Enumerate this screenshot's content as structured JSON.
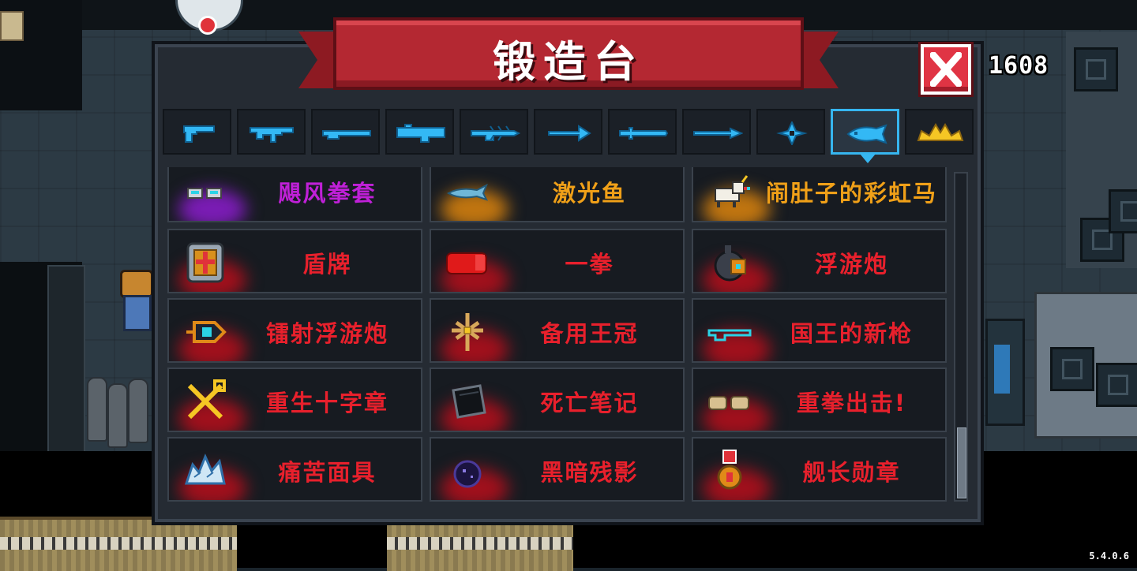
{
  "header": {
    "title": "锻造台",
    "coins": "1608"
  },
  "version": "5.4.0.6",
  "tabs": [
    {
      "icon": "pistol-icon"
    },
    {
      "icon": "assault-rifle-icon"
    },
    {
      "icon": "shotgun-icon"
    },
    {
      "icon": "heavy-gun-icon"
    },
    {
      "icon": "spiky-gun-icon"
    },
    {
      "icon": "bow-icon"
    },
    {
      "icon": "sword-icon"
    },
    {
      "icon": "spear-icon"
    },
    {
      "icon": "shuriken-icon"
    },
    {
      "icon": "fish-icon",
      "selected": true
    },
    {
      "icon": "crown-icon"
    }
  ],
  "items": [
    {
      "name": "飓风拳套",
      "color": "#c020d8",
      "glow": "#7a1cb4",
      "icon": "hurricane-gauntlet-icon"
    },
    {
      "name": "激光鱼",
      "color": "#f0a018",
      "glow": "#c07510",
      "icon": "laser-fish-icon"
    },
    {
      "name": "闹肚子的彩虹马",
      "color": "#f0a018",
      "glow": "#c07510",
      "icon": "rainbow-unicorn-icon"
    },
    {
      "name": "盾牌",
      "color": "#e8202c",
      "glow": "#a0101c",
      "icon": "shield-icon"
    },
    {
      "name": "一拳",
      "color": "#e8202c",
      "glow": "#a0101c",
      "icon": "red-fist-icon"
    },
    {
      "name": "浮游炮",
      "color": "#e8202c",
      "glow": "#a0101c",
      "icon": "floating-cannon-icon"
    },
    {
      "name": "镭射浮游炮",
      "color": "#e8202c",
      "glow": "#a0101c",
      "icon": "laser-floating-cannon-icon"
    },
    {
      "name": "备用王冠",
      "color": "#e8202c",
      "glow": "#a0101c",
      "icon": "spare-crown-icon"
    },
    {
      "name": "国王的新枪",
      "color": "#e8202c",
      "glow": "#a0101c",
      "icon": "kings-new-gun-icon"
    },
    {
      "name": "重生十字章",
      "color": "#e8202c",
      "glow": "#a0101c",
      "icon": "rebirth-cross-icon"
    },
    {
      "name": "死亡笔记",
      "color": "#e8202c",
      "glow": "#a0101c",
      "icon": "death-note-icon"
    },
    {
      "name": "重拳出击!",
      "color": "#e8202c",
      "glow": "#a0101c",
      "icon": "heavy-punch-icon"
    },
    {
      "name": "痛苦面具",
      "color": "#e8202c",
      "glow": "#a0101c",
      "icon": "pain-mask-icon"
    },
    {
      "name": "黑暗残影",
      "color": "#e8202c",
      "glow": "#a0101c",
      "icon": "dark-shadow-icon"
    },
    {
      "name": "舰长勋章",
      "color": "#e8202c",
      "glow": "#a0101c",
      "icon": "captain-medal-icon"
    }
  ],
  "colors": {
    "accent_cyan": "#36b6f0",
    "banner_red": "#b42832",
    "close_red": "#e03444",
    "panel_bg": "#252b33"
  }
}
